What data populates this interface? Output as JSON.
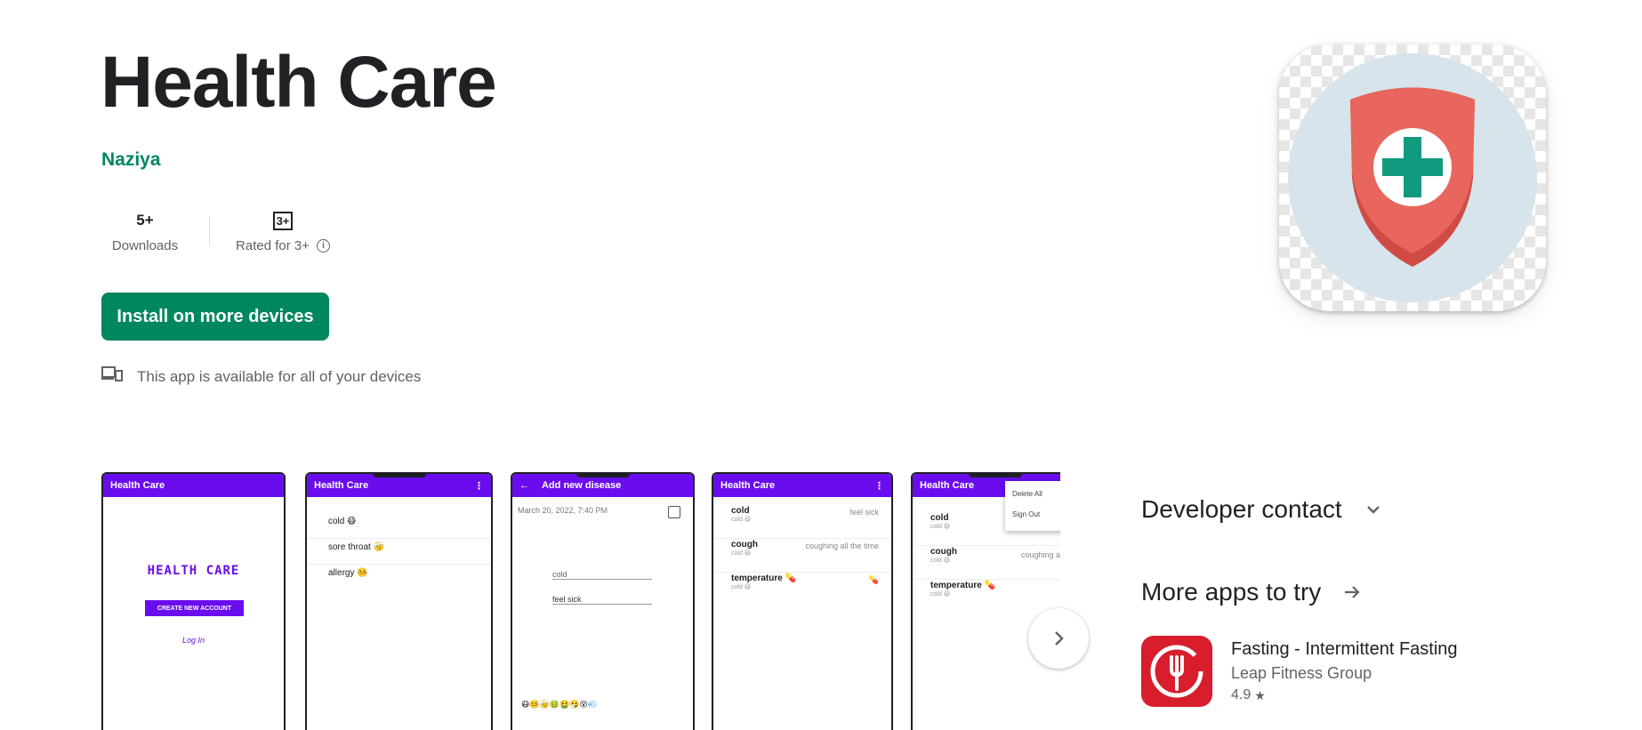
{
  "app": {
    "title": "Health Care",
    "developer": "Naziya",
    "downloads_value": "5+",
    "downloads_label": "Downloads",
    "rating_badge": "3+",
    "rating_label": "Rated for 3+",
    "install_label": "Install on more devices",
    "devices_note": "This app is available for all of your devices"
  },
  "icons": {
    "app_icon": "health-shield-icon",
    "devices": "devices-icon",
    "info": "info-icon",
    "next": "chevron-right-icon",
    "expand": "chevron-down-icon",
    "arrow": "arrow-right-icon",
    "star": "star-icon"
  },
  "colors": {
    "accent": "#01875f",
    "app_bar": "#6a0dee",
    "shield": "#e8665d",
    "cross": "#109b7f",
    "icon_bg": "#d7e4ec"
  },
  "screenshots": [
    {
      "bar_title": "Health Care",
      "logo_text": "HEALTH CARE",
      "button": "CREATE NEW ACCOUNT",
      "link": "Log In"
    },
    {
      "bar_title": "Health Care",
      "items": [
        "cold 😷",
        "sore throat 🤕",
        "allergy 🤒"
      ]
    },
    {
      "bar_title": "Add new disease",
      "date": "March 20, 2022, 7:40 PM",
      "field1": "cold",
      "field2": "feel sick",
      "emojis": "😷🤒🤕🤢🤮🤧😵💨"
    },
    {
      "bar_title": "Health Care",
      "rows": [
        {
          "name": "cold",
          "sub": "cold 😷",
          "note": "feel sick"
        },
        {
          "name": "cough",
          "sub": "cold 😷",
          "note": "coughing all the time"
        },
        {
          "name": "temperature 💊",
          "sub": "cold 😷",
          "note": "💊"
        }
      ]
    },
    {
      "bar_title": "Health Care",
      "menu": [
        "Delete All",
        "Sign Out"
      ],
      "rows": [
        {
          "name": "cold",
          "sub": "cold 😷",
          "note": ""
        },
        {
          "name": "cough",
          "sub": "cold 😷",
          "note": "coughing all the t"
        },
        {
          "name": "temperature 💊",
          "sub": "cold 😷",
          "note": ""
        }
      ]
    }
  ],
  "sidebar": {
    "developer_contact": "Developer contact",
    "more_apps": "More apps to try",
    "suggested": {
      "name": "Fasting - Intermittent Fasting",
      "developer": "Leap Fitness Group",
      "rating": "4.9"
    }
  }
}
